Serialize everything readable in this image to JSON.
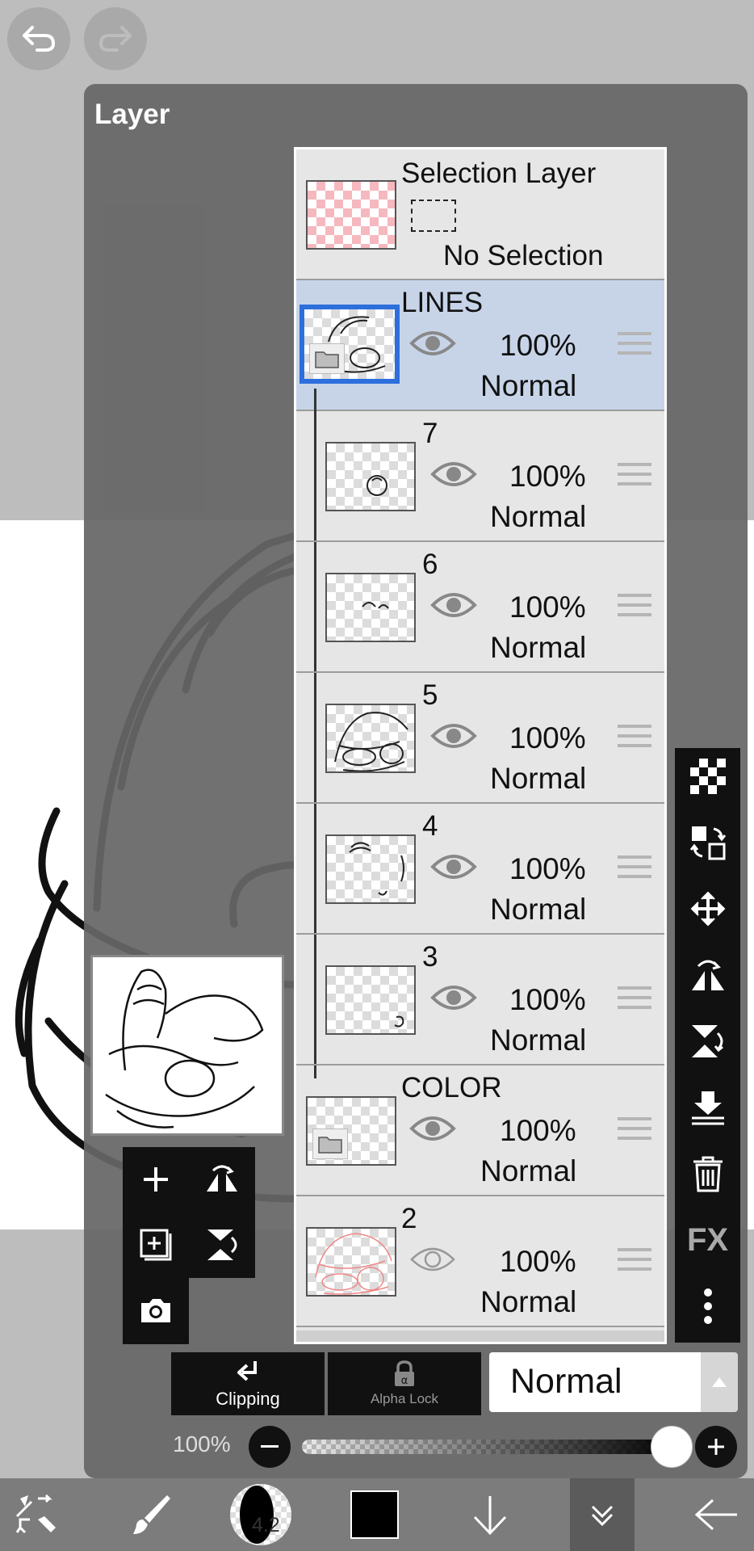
{
  "panel": {
    "title": "Layer"
  },
  "selection_layer": {
    "name": "Selection Layer",
    "status": "No Selection"
  },
  "layers": [
    {
      "name": "LINES",
      "opacity": "100%",
      "blend": "Normal",
      "type": "folder",
      "selected": true,
      "visible": true
    },
    {
      "name": "7",
      "opacity": "100%",
      "blend": "Normal",
      "type": "layer",
      "visible": true
    },
    {
      "name": "6",
      "opacity": "100%",
      "blend": "Normal",
      "type": "layer",
      "visible": true
    },
    {
      "name": "5",
      "opacity": "100%",
      "blend": "Normal",
      "type": "layer",
      "visible": true
    },
    {
      "name": "4",
      "opacity": "100%",
      "blend": "Normal",
      "type": "layer",
      "visible": true
    },
    {
      "name": "3",
      "opacity": "100%",
      "blend": "Normal",
      "type": "layer",
      "visible": true
    },
    {
      "name": "COLOR",
      "opacity": "100%",
      "blend": "Normal",
      "type": "folder",
      "visible": true
    },
    {
      "name": "2",
      "opacity": "100%",
      "blend": "Normal",
      "type": "layer",
      "visible": false
    }
  ],
  "options": {
    "clipping_label": "Clipping",
    "alpha_lock_label": "Alpha Lock",
    "blend_mode": "Normal",
    "opacity_label": "100%",
    "opacity_value": 1.0
  },
  "right_tools": {
    "fx_label": "FX",
    "items": [
      "transparency-icon",
      "layer-swap-icon",
      "move-icon",
      "flip-horizontal-icon",
      "flip-vertical-icon",
      "merge-down-icon",
      "trash-icon",
      "fx",
      "more-icon"
    ]
  },
  "bottom_bar": {
    "brush_size": "4.2",
    "color": "#000000",
    "items": [
      "transform-tool-icon",
      "brush-icon",
      "brush-size",
      "color-swatch",
      "move-down-icon",
      "expand-menu-icon",
      "back-arrow-icon"
    ]
  },
  "colors": {
    "selected_row": "#c7d4e8",
    "selected_thumb_border": "#2d6fdc",
    "panel_bg": "#666666"
  }
}
